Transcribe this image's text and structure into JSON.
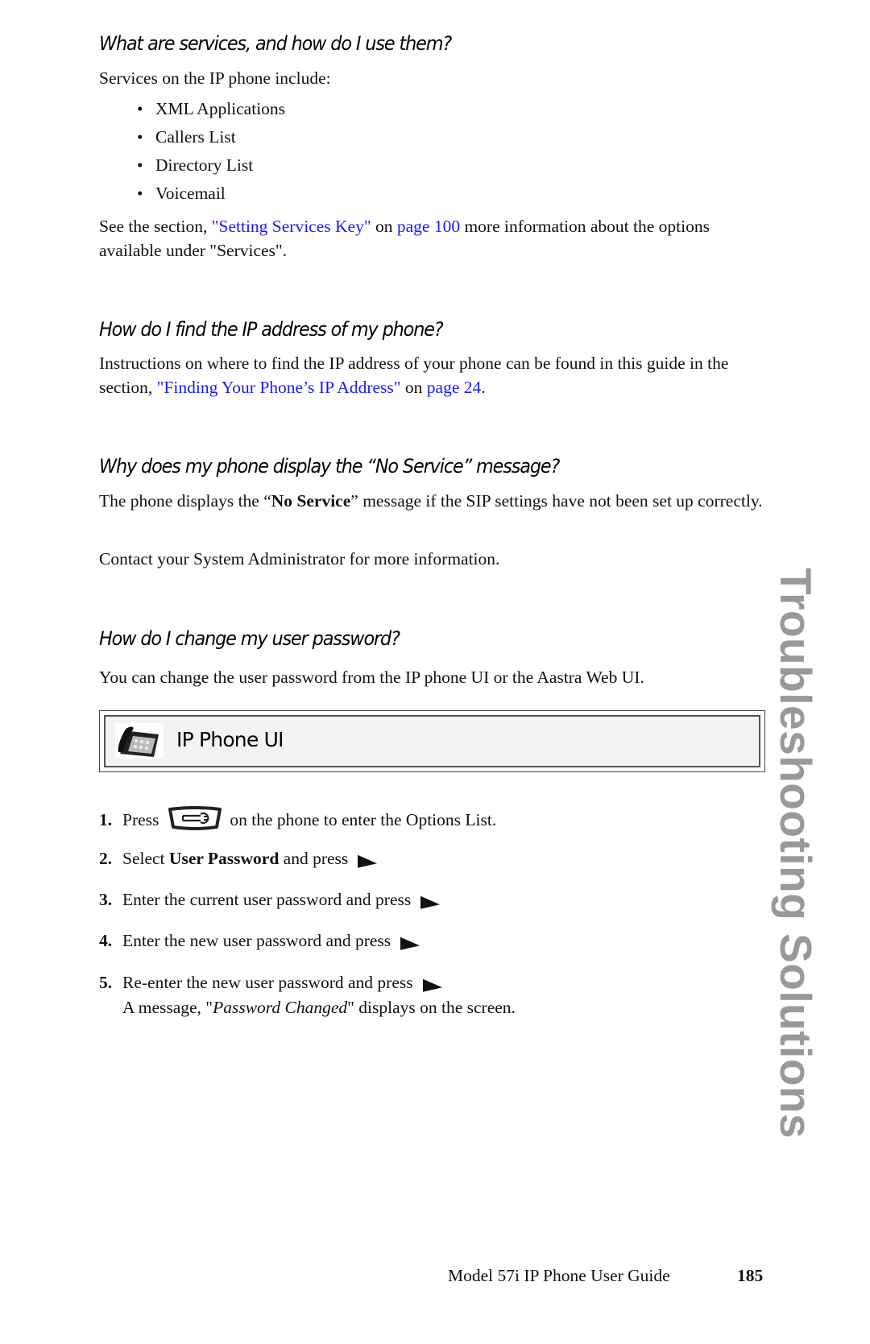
{
  "sections": [
    {
      "heading": "What are services, and how do I use them?",
      "intro": "Services on the IP phone include:",
      "bullets": [
        "XML Applications",
        "Callers List",
        "Directory List",
        "Voicemail"
      ],
      "see_also": {
        "prefix": "See the section, ",
        "link_text": "\"Setting Services Key\"",
        "mid": " on ",
        "page_link": "page 100",
        "suffix": " more information about the options available under \"Services\"."
      }
    },
    {
      "heading": "How do I find the IP address of my phone?",
      "text_prefix": "Instructions on where to find the IP address of your phone can be found in this guide in the section, ",
      "link_text": "\"Finding Your Phone’s IP Address\"",
      "mid": " on ",
      "page_link": "page 24",
      "suffix": "."
    },
    {
      "heading": "Why does my phone display the “No Service” message?",
      "text_prefix": "The phone displays the “",
      "bold": "No Service",
      "text_suffix": "” message if the SIP settings have not been set up correctly.",
      "para2": "Contact your System Administrator for more information."
    },
    {
      "heading": "How do I change my user password?",
      "intro": "You can change the user password from the IP phone UI or the Aastra Web UI.",
      "box_title": "IP Phone UI",
      "steps": [
        {
          "num": "1.",
          "pre": "Press",
          "icon": "options-key-icon",
          "post": "on the phone to enter the Options List."
        },
        {
          "num": "2.",
          "pre": "Select ",
          "bold": "User Password",
          "post": " and press",
          "icon": "right-arrow-key-icon"
        },
        {
          "num": "3.",
          "pre": "Enter the current user password and press",
          "icon": "right-arrow-key-icon"
        },
        {
          "num": "4.",
          "pre": "Enter the new user password and press",
          "icon": "right-arrow-key-icon"
        },
        {
          "num": "5.",
          "pre": "Re-enter the new user password and press",
          "icon": "right-arrow-key-icon",
          "note_prefix": "A message, \"",
          "note_italic": "Password Changed",
          "note_suffix": "\" displays on the screen."
        }
      ]
    }
  ],
  "sidebar_tab": "Troubleshooting Solutions",
  "footer": {
    "guide_title": "Model 57i IP Phone User Guide",
    "page_number": "185"
  },
  "colors": {
    "link": "#1a1aff",
    "sidebar_text": "#999999",
    "box_fill": "#f3f3f3"
  }
}
